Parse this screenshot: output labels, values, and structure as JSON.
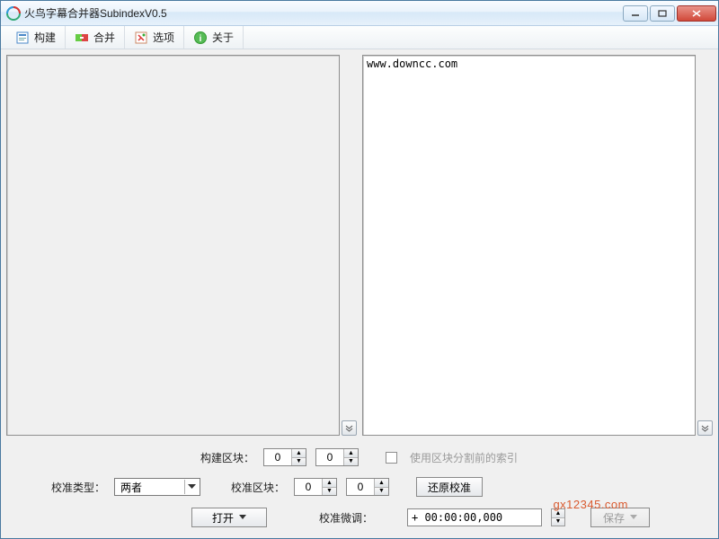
{
  "title": "火鸟字幕合并器SubindexV0.5",
  "toolbar": {
    "build": "构建",
    "merge": "合并",
    "options": "选项",
    "about": "关于"
  },
  "right_pane_text": "www.downcc.com",
  "controls": {
    "build_block_label": "构建区块：",
    "build_block_a": "0",
    "build_block_b": "0",
    "use_presplit_index": "使用区块分割前的索引",
    "calib_type_label": "校准类型：",
    "calib_type_value": "两者",
    "calib_block_label": "校准区块：",
    "calib_block_a": "0",
    "calib_block_b": "0",
    "restore_calib": "还原校准",
    "open": "打开",
    "calib_fine_label": "校准微调：",
    "calib_fine_value": "+ 00:00:00,000",
    "save": "保存"
  },
  "watermark": "gx12345.com"
}
